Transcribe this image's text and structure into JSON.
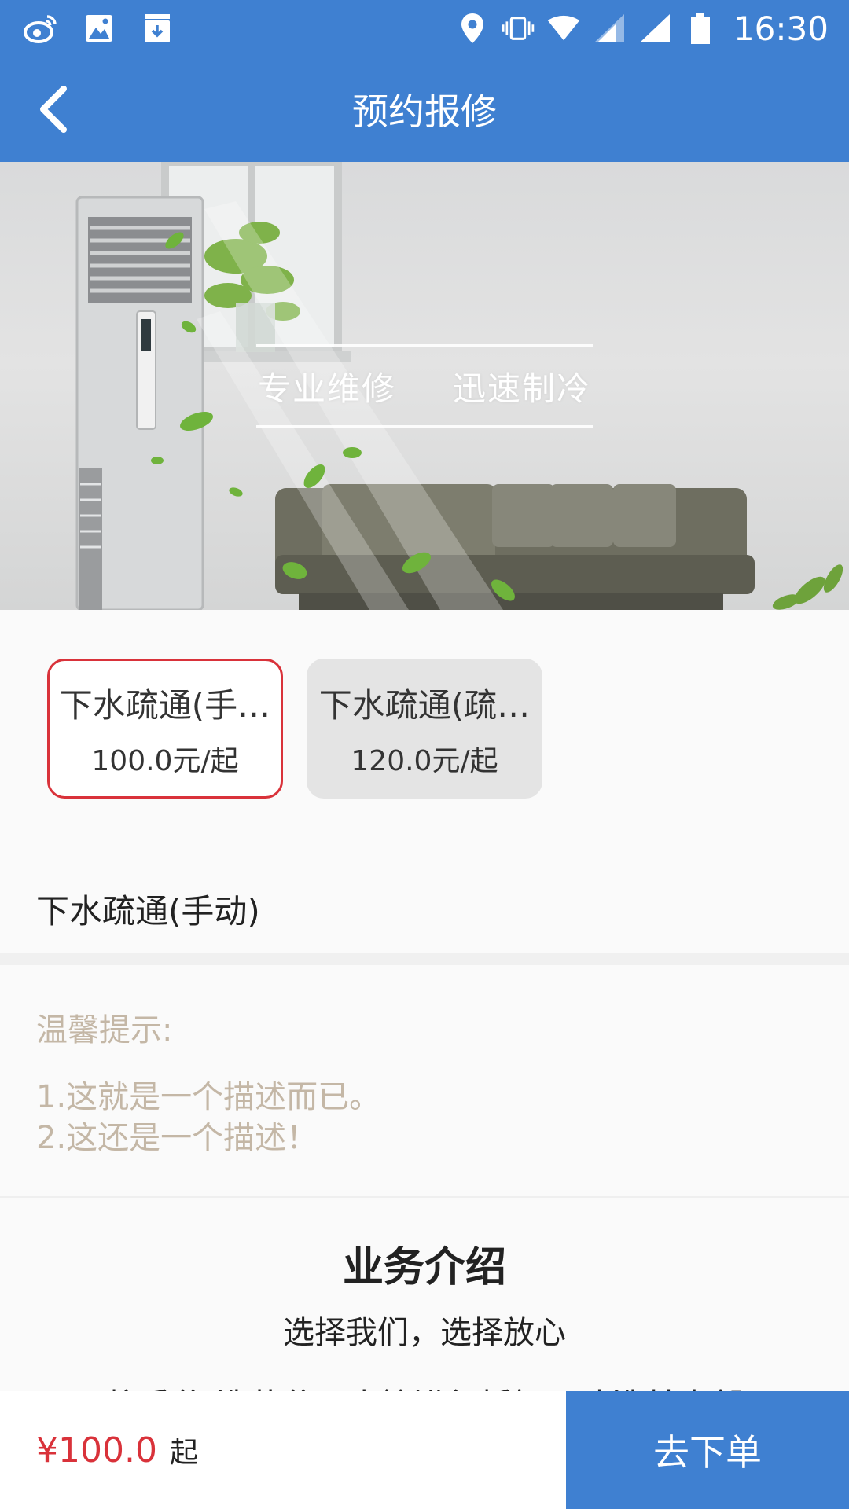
{
  "status_bar": {
    "time": "16:30",
    "left_icons": [
      "weibo-icon",
      "image-icon",
      "download-icon"
    ],
    "right_icons": [
      "location-icon",
      "vibrate-icon",
      "wifi-icon",
      "signal-icon",
      "signal-icon",
      "battery-icon"
    ]
  },
  "appbar": {
    "title": "预约报修"
  },
  "banner": {
    "slogan_left": "专业维修",
    "slogan_right": "迅速制冷"
  },
  "options": [
    {
      "name": "下水疏通(手…",
      "price": "100.0元/起",
      "selected": true
    },
    {
      "name": "下水疏通(疏…",
      "price": "120.0元/起",
      "selected": false
    }
  ],
  "selected_service": "下水疏通(手动)",
  "tips": {
    "title": "温馨提示:",
    "lines": [
      "1.这就是一个描述而已。",
      "2.这还是一个描述！"
    ]
  },
  "intro": {
    "title": "业务介绍",
    "subtitle": "选择我们，选择放心",
    "body": "将手盆/洗菜盆下水管进行拆卸，冲洗其内部"
  },
  "bottom": {
    "price": "¥100.0",
    "price_suffix": "起",
    "order_label": "去下单"
  },
  "colors": {
    "primary": "#3f80d1",
    "accent_red": "#d9323a",
    "tip_text": "#c4b7a6"
  }
}
